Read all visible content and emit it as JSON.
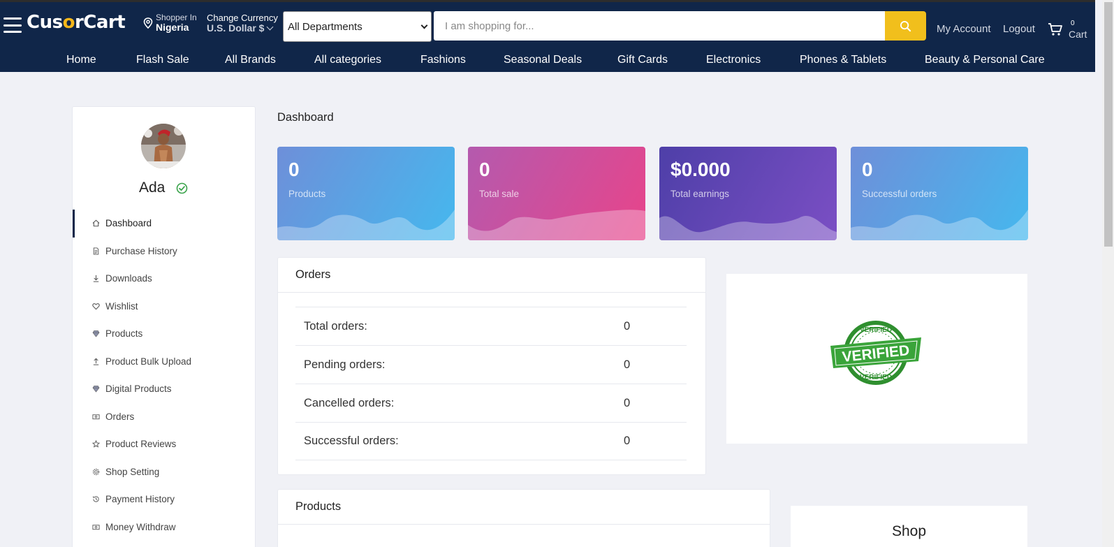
{
  "header": {
    "logo_text": "CusorCart",
    "shopper_in_label": "Shopper In",
    "shopper_in_value": "Nigeria",
    "currency_label": "Change Currency",
    "currency_value": "U.S. Dollar $",
    "department_select": "All Departments",
    "search_placeholder": "I am shopping for...",
    "my_account": "My Account",
    "logout": "Logout",
    "cart_count": "0",
    "cart_label": "Cart",
    "icons": [
      "menu-icon",
      "location-pin-icon",
      "chevron-down-icon",
      "search-icon",
      "cart-icon"
    ],
    "colors": {
      "header_bg": "#102649",
      "accent": "#f1bf1c"
    }
  },
  "nav": [
    "Home",
    "Flash Sale",
    "All Brands",
    "All categories",
    "Fashions",
    "Seasonal Deals",
    "Gift Cards",
    "Electronics",
    "Phones & Tablets",
    "Beauty & Personal Care"
  ],
  "sidebar": {
    "user_name": "Ada",
    "items": [
      {
        "label": "Dashboard",
        "icon": "home-icon",
        "active": true
      },
      {
        "label": "Purchase History",
        "icon": "file-icon"
      },
      {
        "label": "Downloads",
        "icon": "download-icon"
      },
      {
        "label": "Wishlist",
        "icon": "heart-icon"
      },
      {
        "label": "Products",
        "icon": "diamond-icon"
      },
      {
        "label": "Product Bulk Upload",
        "icon": "upload-icon"
      },
      {
        "label": "Digital Products",
        "icon": "diamond-icon"
      },
      {
        "label": "Orders",
        "icon": "money-icon"
      },
      {
        "label": "Product Reviews",
        "icon": "star-icon"
      },
      {
        "label": "Shop Setting",
        "icon": "gear-icon"
      },
      {
        "label": "Payment History",
        "icon": "history-icon"
      },
      {
        "label": "Money Withdraw",
        "icon": "money-icon"
      }
    ]
  },
  "main": {
    "title": "Dashboard",
    "stats": [
      {
        "value": "0",
        "label": "Products"
      },
      {
        "value": "0",
        "label": "Total sale"
      },
      {
        "value": "$0.000",
        "label": "Total earnings"
      },
      {
        "value": "0",
        "label": "Successful orders"
      }
    ],
    "orders": {
      "title": "Orders",
      "rows": [
        {
          "label": "Total orders:",
          "value": "0"
        },
        {
          "label": "Pending orders:",
          "value": "0"
        },
        {
          "label": "Cancelled orders:",
          "value": "0"
        },
        {
          "label": "Successful orders:",
          "value": "0"
        }
      ]
    },
    "verified_badge": {
      "top_text": "VERIFIED",
      "middle_text": "VERIFIED",
      "bottom_text": "VERIFIED"
    },
    "products_title": "Products",
    "shop_title": "Shop"
  }
}
